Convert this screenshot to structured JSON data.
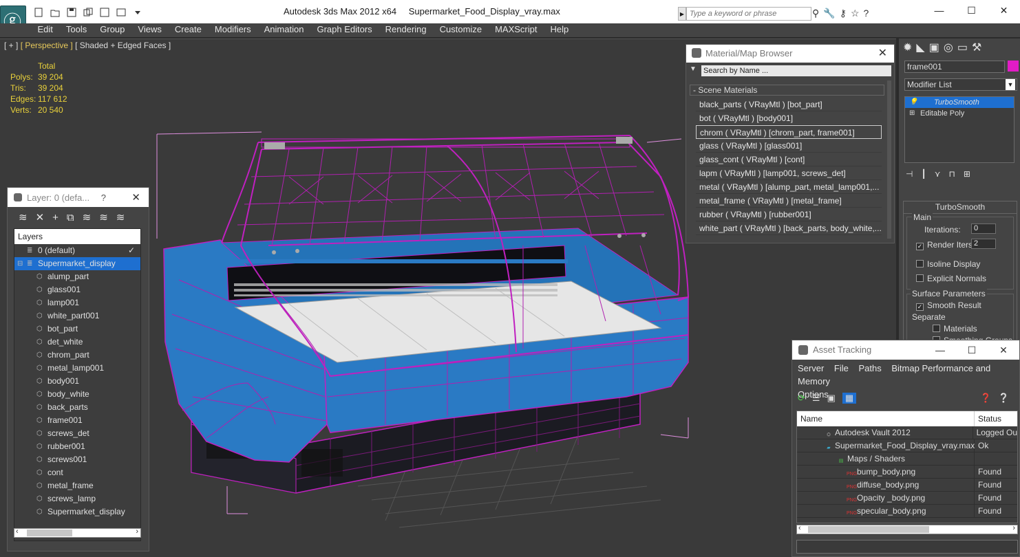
{
  "titlebar": {
    "app_title": "Autodesk 3ds Max  2012 x64",
    "file_name": "Supermarket_Food_Display_vray.max",
    "search_placeholder": "Type a keyword or phrase"
  },
  "menubar": {
    "items": [
      "Edit",
      "Tools",
      "Group",
      "Views",
      "Create",
      "Modifiers",
      "Animation",
      "Graph Editors",
      "Rendering",
      "Customize",
      "MAXScript",
      "Help"
    ]
  },
  "viewport": {
    "label_plus": "[ + ]",
    "label_view": "[ Perspective ]",
    "label_shading": "[ Shaded + Edged Faces ]",
    "stats": {
      "header": "Total",
      "polys_label": "Polys:",
      "polys": "39 204",
      "tris_label": "Tris:",
      "tris": "39 204",
      "edges_label": "Edges:",
      "edges": "117 612",
      "verts_label": "Verts:",
      "verts": "20 540"
    }
  },
  "layer_panel": {
    "title": "Layer: 0 (defa...",
    "help": "?",
    "header": "Layers",
    "default_layer": "0 (default)",
    "active_layer": "Supermarket_display",
    "objects": [
      "alump_part",
      "glass001",
      "lamp001",
      "white_part001",
      "bot_part",
      "det_white",
      "chrom_part",
      "metal_lamp001",
      "body001",
      "body_white",
      "back_parts",
      "frame001",
      "screws_det",
      "rubber001",
      "screws001",
      "cont",
      "metal_frame",
      "screws_lamp",
      "Supermarket_display"
    ]
  },
  "material_browser": {
    "title": "Material/Map Browser",
    "search_placeholder": "Search by Name ...",
    "section": "- Scene Materials",
    "materials": [
      "black_parts  ( VRayMtl ) [bot_part]",
      "bot  ( VRayMtl ) [body001]",
      "chrom  ( VRayMtl ) [chrom_part, frame001]",
      "glass  ( VRayMtl ) [glass001]",
      "glass_cont  ( VRayMtl ) [cont]",
      "lapm  ( VRayMtl ) [lamp001, screws_det]",
      "metal  ( VRayMtl ) [alump_part, metal_lamp001,...",
      "metal_frame  ( VRayMtl ) [metal_frame]",
      "rubber  ( VRayMtl ) [rubber001]",
      "white_part  ( VRayMtl ) [back_parts, body_white,..."
    ],
    "selected_index": 2
  },
  "command_panel": {
    "object_name": "frame001",
    "object_color": "#e21cc6",
    "modifier_list": "Modifier List",
    "stack": [
      "TurboSmooth",
      "Editable Poly"
    ],
    "rollout_title": "TurboSmooth",
    "main_group": "Main",
    "iterations_label": "Iterations:",
    "iterations": "0",
    "render_iters_label": "Render Iters:",
    "render_iters": "2",
    "isoline_label": "Isoline Display",
    "explicit_label": "Explicit Normals",
    "surface_group": "Surface Parameters",
    "smooth_result_label": "Smooth Result",
    "separate_label": "Separate",
    "materials_label": "Materials",
    "smoothing_label": "Smoothing Groups"
  },
  "asset_tracking": {
    "title": "Asset Tracking",
    "menu": [
      "Server",
      "File",
      "Paths",
      "Bitmap Performance and Memory",
      "Options"
    ],
    "col_name": "Name",
    "col_status": "Status",
    "rows": [
      {
        "name": "Autodesk Vault 2012",
        "status": "Logged Ou",
        "indent": 40
      },
      {
        "name": "Supermarket_Food_Display_vray.max",
        "status": "Ok",
        "indent": 40
      },
      {
        "name": "Maps / Shaders",
        "status": "",
        "indent": 58
      },
      {
        "name": "bump_body.png",
        "status": "Found",
        "indent": 72
      },
      {
        "name": "diffuse_body.png",
        "status": "Found",
        "indent": 72
      },
      {
        "name": "Opacity _body.png",
        "status": "Found",
        "indent": 72
      },
      {
        "name": "specular_body.png",
        "status": "Found",
        "indent": 72
      }
    ]
  },
  "colors": {
    "wire_pink": "#c020c0",
    "body_blue": "#2a7ac4",
    "selection_blue": "#1e6fd0",
    "stats_yellow": "#e9d13a"
  }
}
